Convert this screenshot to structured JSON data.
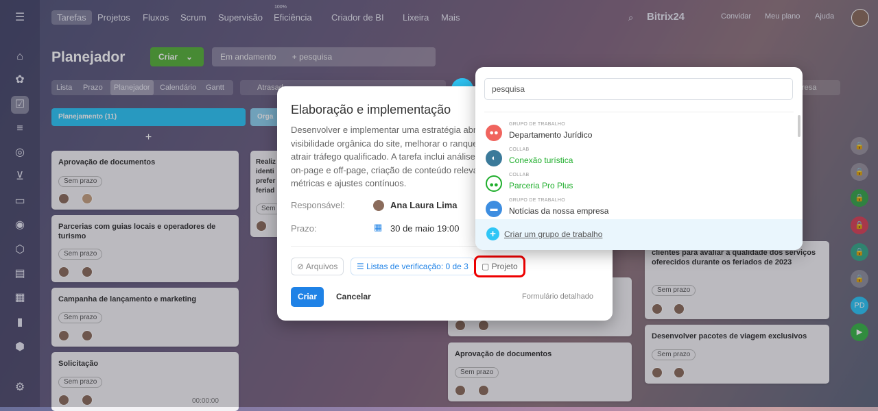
{
  "topnav": {
    "tabs": [
      "Tarefas",
      "Projetos",
      "Fluxos",
      "Scrum",
      "Supervisão",
      "Eficiência",
      "Criador de BI",
      "Lixeira",
      "Mais"
    ],
    "efficiency_badge": "100%",
    "brand": "Bitrix24",
    "invite": "Convidar",
    "plan": "Meu plano",
    "help": "Ajuda"
  },
  "page": {
    "title": "Planejador",
    "create_btn": "Criar",
    "filter_chip": "Em andamento",
    "search_placeholder": "+ pesquisa",
    "view_tabs": [
      "Lista",
      "Prazo",
      "Planejador",
      "Calendário",
      "Gantt"
    ],
    "overdue": "Atrasad",
    "right_label": "resa"
  },
  "columns": [
    {
      "title": "Planejamento (11)",
      "color": "#2fc6f6"
    },
    {
      "title": "Orga",
      "color": "#8fd0ee"
    }
  ],
  "cards_col1": [
    {
      "title": "Aprovação de documentos",
      "badge": "Sem prazo"
    },
    {
      "title": "Parcerias com guias locais e operadores de turismo",
      "badge": "Sem prazo"
    },
    {
      "title": "Campanha de lançamento e marketing",
      "badge": "Sem prazo"
    },
    {
      "title": "Solicitação",
      "badge": "Sem prazo",
      "time": "00:00:00"
    }
  ],
  "card_col2": {
    "title": "Realiz identi prefer feriad",
    "badge": "Sem"
  },
  "cards_right": [
    {
      "title": "clientes para avaliar a qualidade dos serviços oferecidos durante os feriados de 2023",
      "badge": "Sem prazo"
    },
    {
      "title": "Desenvolver pacotes de viagem exclusivos",
      "badge": "Sem prazo"
    }
  ],
  "card_mid": {
    "title": "Aprovação de documentos",
    "badge": "Sem prazo"
  },
  "modal": {
    "title": "Elaboração e implementação",
    "description": "Desenvolver e implementar uma estratégia abrar\nvisibilidade orgânica do site, melhorar o ranque\natrair tráfego qualificado. A tarefa inclui análise d\non-page e off-page, criação de conteúdo relevan\nmétricas e ajustes contínuos.",
    "responsible_label": "Responsável:",
    "responsible_value": "Ana Laura Lima",
    "deadline_label": "Prazo:",
    "deadline_value": "30 de maio 19:00",
    "files": "Arquivos",
    "checklist": "Listas de verificação: 0 de 3",
    "project": "Projeto",
    "create": "Criar",
    "cancel": "Cancelar",
    "detailed": "Formulário detalhado"
  },
  "dropdown": {
    "search": "pesquisa",
    "items": [
      {
        "type": "GRUPO DE TRABALHO",
        "name": "Departamento Jurídico",
        "color": "#f0645e",
        "name_color": "#333"
      },
      {
        "type": "COLLAB",
        "name": "Conexão turística",
        "color": "#3b7a9a",
        "name_color": "#1fae2c"
      },
      {
        "type": "COLLAB",
        "name": "Parceria Pro Plus",
        "color": "#ffffff",
        "name_color": "#1fae2c"
      },
      {
        "type": "GRUPO DE TRABALHO",
        "name": "Notícias da nossa empresa",
        "color": "#3d8de0",
        "name_color": "#333"
      }
    ],
    "create": "Criar um grupo de trabalho"
  }
}
